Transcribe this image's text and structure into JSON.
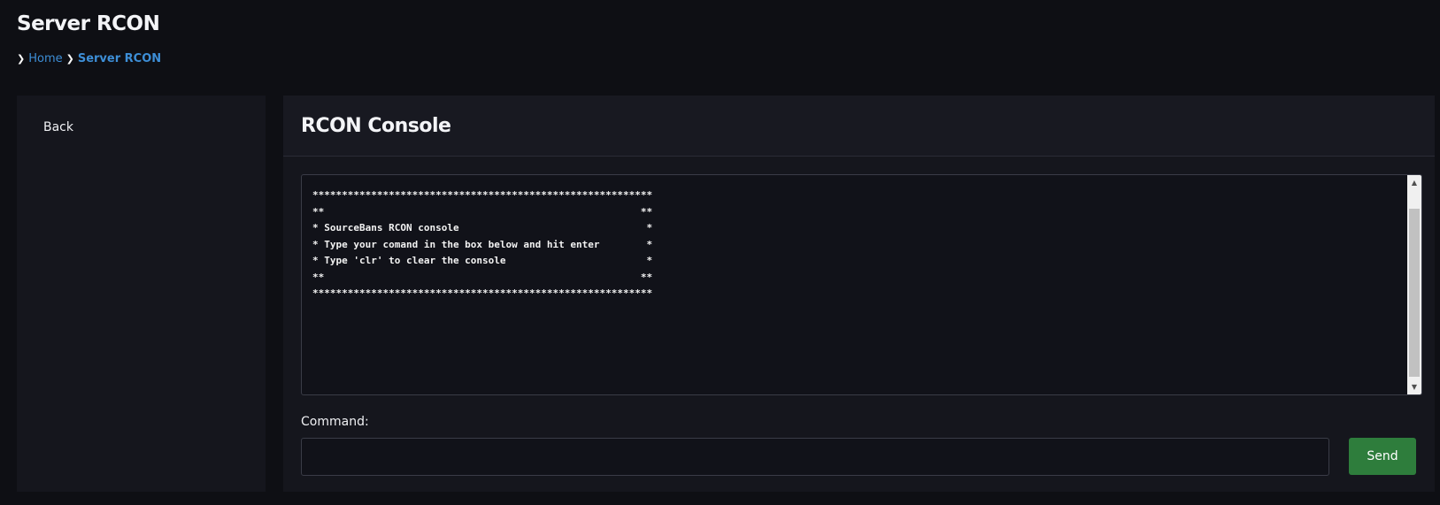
{
  "page": {
    "title": "Server RCON"
  },
  "breadcrumb": {
    "items": [
      {
        "label": "Home"
      },
      {
        "label": "Server RCON"
      }
    ]
  },
  "sidebar": {
    "back_label": "Back"
  },
  "panel": {
    "title": "RCON Console"
  },
  "console": {
    "text": "**********************************************************\n**                                                      **\n* SourceBans RCON console                                *\n* Type your comand in the box below and hit enter        *\n* Type 'clr' to clear the console                        *\n**                                                      **\n**********************************************************"
  },
  "command": {
    "label": "Command:",
    "value": "",
    "placeholder": ""
  },
  "send_button": {
    "label": "Send"
  },
  "colors": {
    "background": "#0e0f14",
    "panel": "#15161d",
    "link": "#3d8ed6",
    "send_button": "#2e7d3c"
  },
  "icons": {
    "breadcrumb_separator": "chevron-right-icon"
  }
}
